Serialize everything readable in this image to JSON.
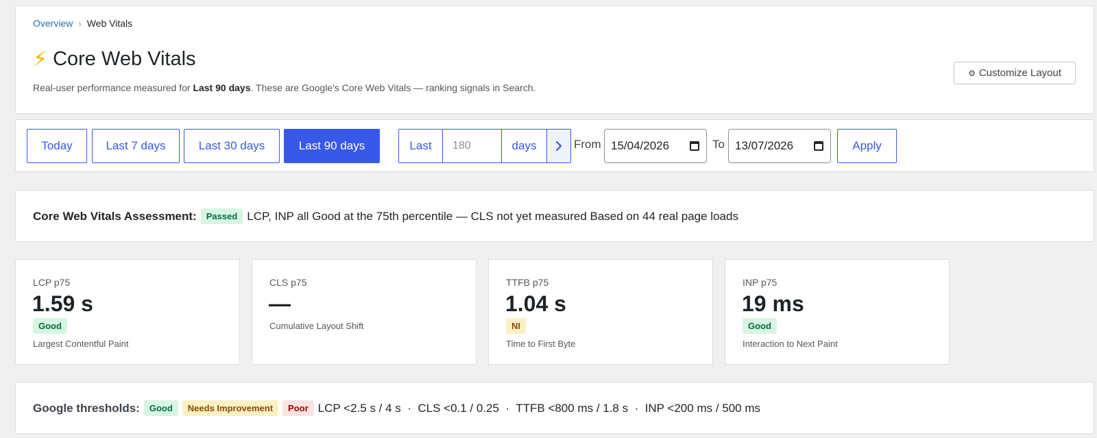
{
  "breadcrumb": {
    "parent": "Overview",
    "separator": "›",
    "current": "Web Vitals"
  },
  "header": {
    "icon": "lightning-bolt-icon",
    "title": "Core Web Vitals",
    "subtitle_prefix": "Real-user performance measured for ",
    "subtitle_period": "Last 90 days",
    "subtitle_suffix": ". These are Google's Core Web Vitals — ranking signals in Search.",
    "customize_icon": "gear-icon",
    "customize_label": "Customize Layout"
  },
  "filters": {
    "ranges": [
      "Today",
      "Last 7 days",
      "Last 30 days",
      "Last 90 days"
    ],
    "active_range": "Last 90 days",
    "custom": {
      "prefix": "Last",
      "placeholder": "180",
      "unit": "days",
      "go_icon": "chevron-right-icon"
    },
    "from_label": "From",
    "from_value": "15/04/2026",
    "to_label": "To",
    "to_value": "13/07/2026",
    "apply_label": "Apply"
  },
  "assessment": {
    "heading": "Core Web Vitals Assessment:",
    "status": "Passed",
    "text": "LCP, INP all Good at the 75th percentile — CLS not yet measured Based on 44 real page loads"
  },
  "metrics": [
    {
      "label": "LCP p75",
      "value": "1.59 s",
      "badge": "Good",
      "description": "Largest Contentful Paint"
    },
    {
      "label": "CLS p75",
      "value": "—",
      "badge": "",
      "description": "Cumulative Layout Shift"
    },
    {
      "label": "TTFB p75",
      "value": "1.04 s",
      "badge": "NI",
      "description": "Time to First Byte"
    },
    {
      "label": "INP p75",
      "value": "19 ms",
      "badge": "Good",
      "description": "Interaction to Next Paint"
    }
  ],
  "thresholds": {
    "heading": "Google thresholds:",
    "good": "Good",
    "ni": "Needs Improvement",
    "poor": "Poor",
    "text": "LCP <2.5 s / 4 s  ·  CLS <0.1 / 0.25  ·  TTFB <800 ms / 1.8 s  ·  INP <200 ms / 500 ms"
  },
  "colors": {
    "accent": "#3858e9",
    "good_bg": "#d8f5e3",
    "ni_bg": "#fcf0c4",
    "poor_bg": "#fde2e2",
    "link": "#2271b1"
  }
}
